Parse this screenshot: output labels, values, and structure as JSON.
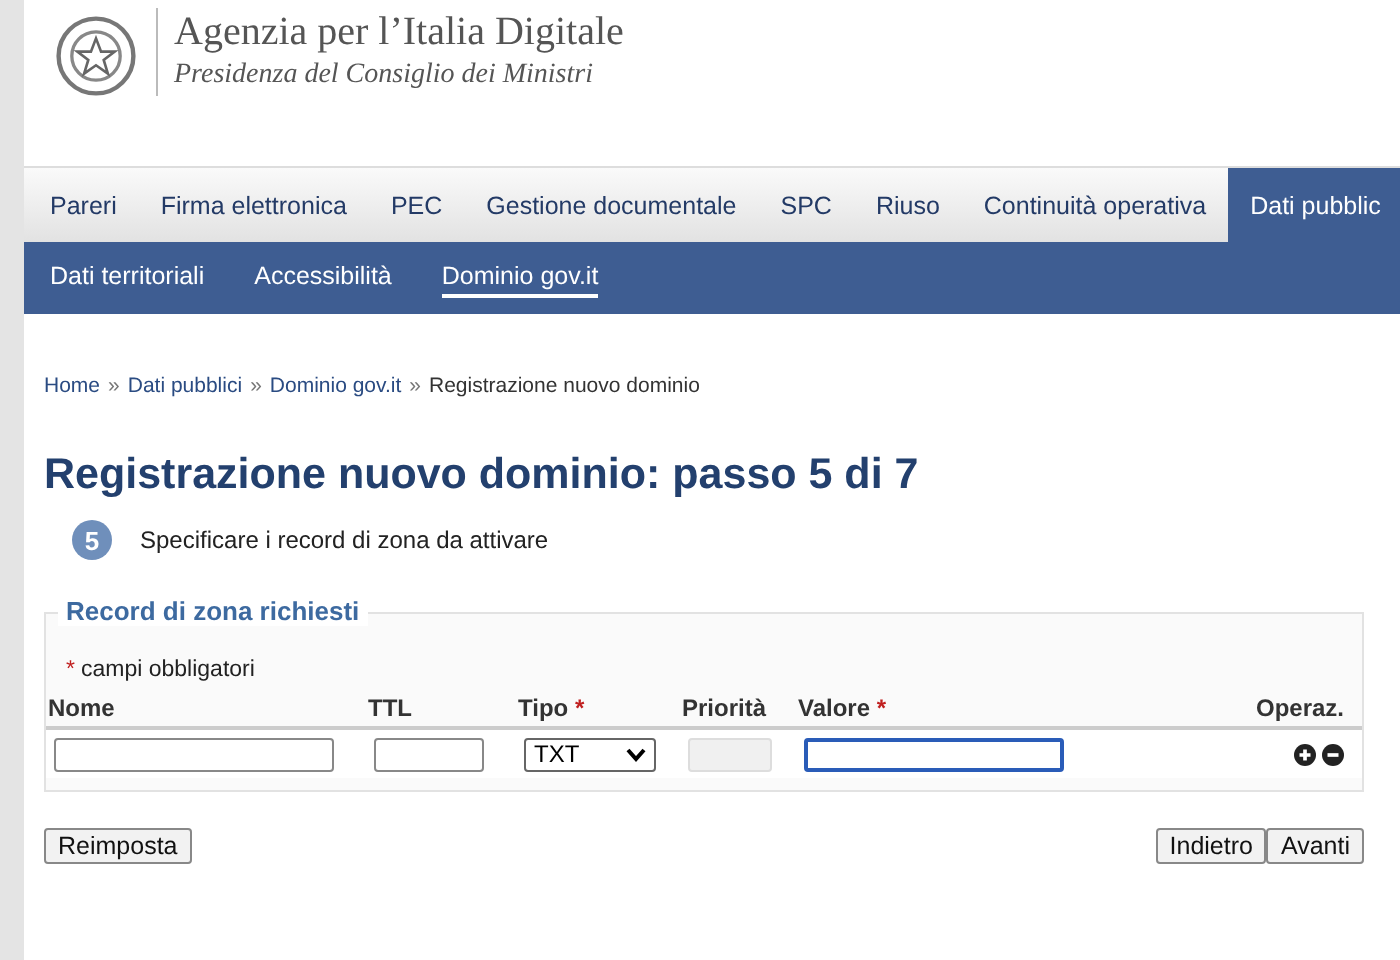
{
  "header": {
    "title": "Agenzia per l’Italia Digitale",
    "subtitle": "Presidenza del Consiglio dei Ministri"
  },
  "tabs": [
    {
      "label": "Pareri",
      "selected": false
    },
    {
      "label": "Firma elettronica",
      "selected": false
    },
    {
      "label": "PEC",
      "selected": false
    },
    {
      "label": "Gestione documentale",
      "selected": false
    },
    {
      "label": "SPC",
      "selected": false
    },
    {
      "label": "Riuso",
      "selected": false
    },
    {
      "label": "Continuità operativa",
      "selected": false
    },
    {
      "label": "Dati pubblic",
      "selected": true
    }
  ],
  "subnav": [
    {
      "label": "Dati territoriali",
      "selected": false
    },
    {
      "label": "Accessibilità",
      "selected": false
    },
    {
      "label": "Dominio gov.it",
      "selected": true
    }
  ],
  "breadcrumb": [
    "Home",
    "Dati pubblici",
    "Dominio gov.it",
    "Registrazione nuovo dominio"
  ],
  "breadcrumb_separator": "»",
  "page_title": "Registrazione nuovo dominio: passo 5 di 7",
  "step": {
    "number": "5",
    "text": "Specificare i record di zona da attivare"
  },
  "fieldset": {
    "legend": "Record di zona richiesti",
    "required_note": "campi obbligatori",
    "required_mark": "*",
    "columns": [
      {
        "label": "Nome",
        "required": false
      },
      {
        "label": "TTL",
        "required": false
      },
      {
        "label": "Tipo",
        "required": true
      },
      {
        "label": "Priorità",
        "required": false
      },
      {
        "label": "Valore",
        "required": true
      },
      {
        "label": "Operaz.",
        "required": false
      }
    ],
    "row": [
      {
        "kind": "text",
        "disabled": false,
        "focused": false
      },
      {
        "kind": "text",
        "disabled": false,
        "focused": false
      },
      {
        "kind": "select",
        "value": "TXT"
      },
      {
        "kind": "text",
        "disabled": true,
        "focused": false
      },
      {
        "kind": "text",
        "disabled": false,
        "focused": true
      },
      {
        "kind": "actions"
      }
    ]
  },
  "buttons_left": [
    "Reimposta"
  ],
  "buttons_right": [
    "Indietro",
    "Avanti"
  ]
}
